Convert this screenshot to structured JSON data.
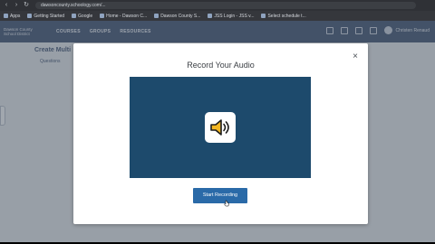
{
  "browser": {
    "url": "dawsoncounty.schoology.com/...",
    "bookmarks": [
      {
        "label": "Apps"
      },
      {
        "label": "Getting Started"
      },
      {
        "label": "Google"
      },
      {
        "label": "Home - Dawson C..."
      },
      {
        "label": "Dawson County S..."
      },
      {
        "label": "JSS Login - JSS v..."
      },
      {
        "label": "Select schedule t..."
      }
    ]
  },
  "header": {
    "logo_line1": "Dawson County",
    "logo_line2": "School District",
    "nav": [
      "COURSES",
      "GROUPS",
      "RESOURCES"
    ],
    "user_name": "Christen Renaud"
  },
  "page": {
    "title": "Create Multi",
    "tab": "Questions"
  },
  "modal": {
    "title": "Record Your Audio",
    "close_symbol": "×",
    "start_button": "Start Recording"
  },
  "colors": {
    "player_bg": "#1d4a6c",
    "button_bg": "#2a6aa8",
    "header_bg": "#4a5b78"
  },
  "icons": {
    "speaker": "speaker-icon",
    "close": "close-icon"
  }
}
